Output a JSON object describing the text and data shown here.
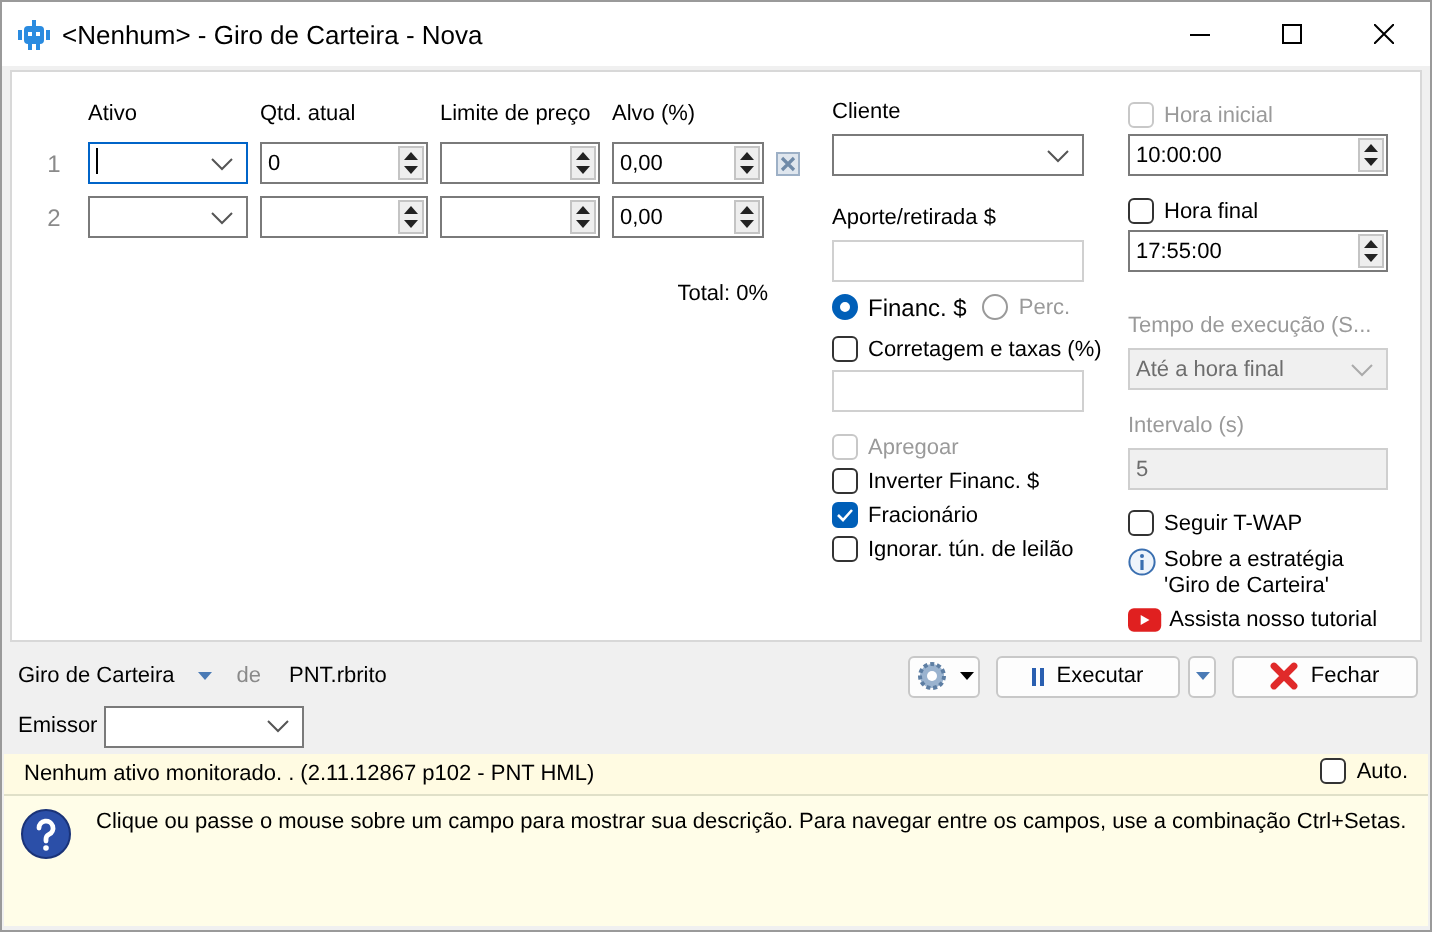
{
  "window": {
    "title": "<Nenhum> - Giro de Carteira - Nova"
  },
  "grid": {
    "columns": [
      "Ativo",
      "Qtd. atual",
      "Limite de preço",
      "Alvo (%)"
    ],
    "rows": [
      {
        "index": "1",
        "focused": true,
        "qtd": "0",
        "alvo": "0,00",
        "removable": true
      },
      {
        "index": "2",
        "focused": false,
        "alvo": "0,00",
        "removable": false
      }
    ],
    "total": "Total: 0%"
  },
  "cliente": {
    "label": "Cliente"
  },
  "aporte": {
    "label": "Aporte/retirada $"
  },
  "radios": [
    {
      "label": "Financ. $",
      "selected": true,
      "disabled": false
    },
    {
      "label": "Perc.",
      "selected": false,
      "disabled": true
    }
  ],
  "corretagem": {
    "label": "Corretagem e taxas (%)",
    "checked": false
  },
  "options": [
    {
      "label": "Apregoar",
      "checked": false,
      "disabled": true
    },
    {
      "label": "Inverter Financ. $",
      "checked": false,
      "disabled": false
    },
    {
      "label": "Fracionário",
      "checked": true,
      "disabled": false
    },
    {
      "label": "Ignorar. tún. de leilão",
      "checked": false,
      "disabled": false
    }
  ],
  "hora_inicial": {
    "label": "Hora inicial",
    "checked": false,
    "disabled": true,
    "value": "10:00:00"
  },
  "hora_final": {
    "label": "Hora final",
    "checked": false,
    "disabled": false,
    "value": "17:55:00"
  },
  "tempo_execucao": {
    "label": "Tempo de execução (S...",
    "value": "Até a hora final",
    "disabled": true
  },
  "intervalo": {
    "label": "Intervalo (s)",
    "value": "5",
    "disabled": true
  },
  "seguir_twap": {
    "label": "Seguir T-WAP",
    "checked": false
  },
  "links": [
    {
      "kind": "info",
      "label": "Sobre a estratégia 'Giro de Carteira'"
    },
    {
      "kind": "video",
      "label": "Assista nosso tutorial"
    }
  ],
  "footer": {
    "strategy": "Giro de Carteira",
    "de": "de",
    "user": "PNT.rbrito",
    "emissor_label": "Emissor",
    "buttons": [
      {
        "kind": "settings"
      },
      {
        "kind": "run",
        "label": "Executar"
      },
      {
        "kind": "dropdown"
      },
      {
        "kind": "close",
        "label": "Fechar"
      }
    ]
  },
  "status": {
    "text": "Nenhum ativo monitorado. .  (2.11.12867 p102 - PNT HML)",
    "auto_label": "Auto.",
    "auto_checked": false
  },
  "help": {
    "text": "Clique ou passe o mouse sobre um campo para mostrar sua descrição. Para navegar entre os campos, use a combinação Ctrl+Setas."
  }
}
